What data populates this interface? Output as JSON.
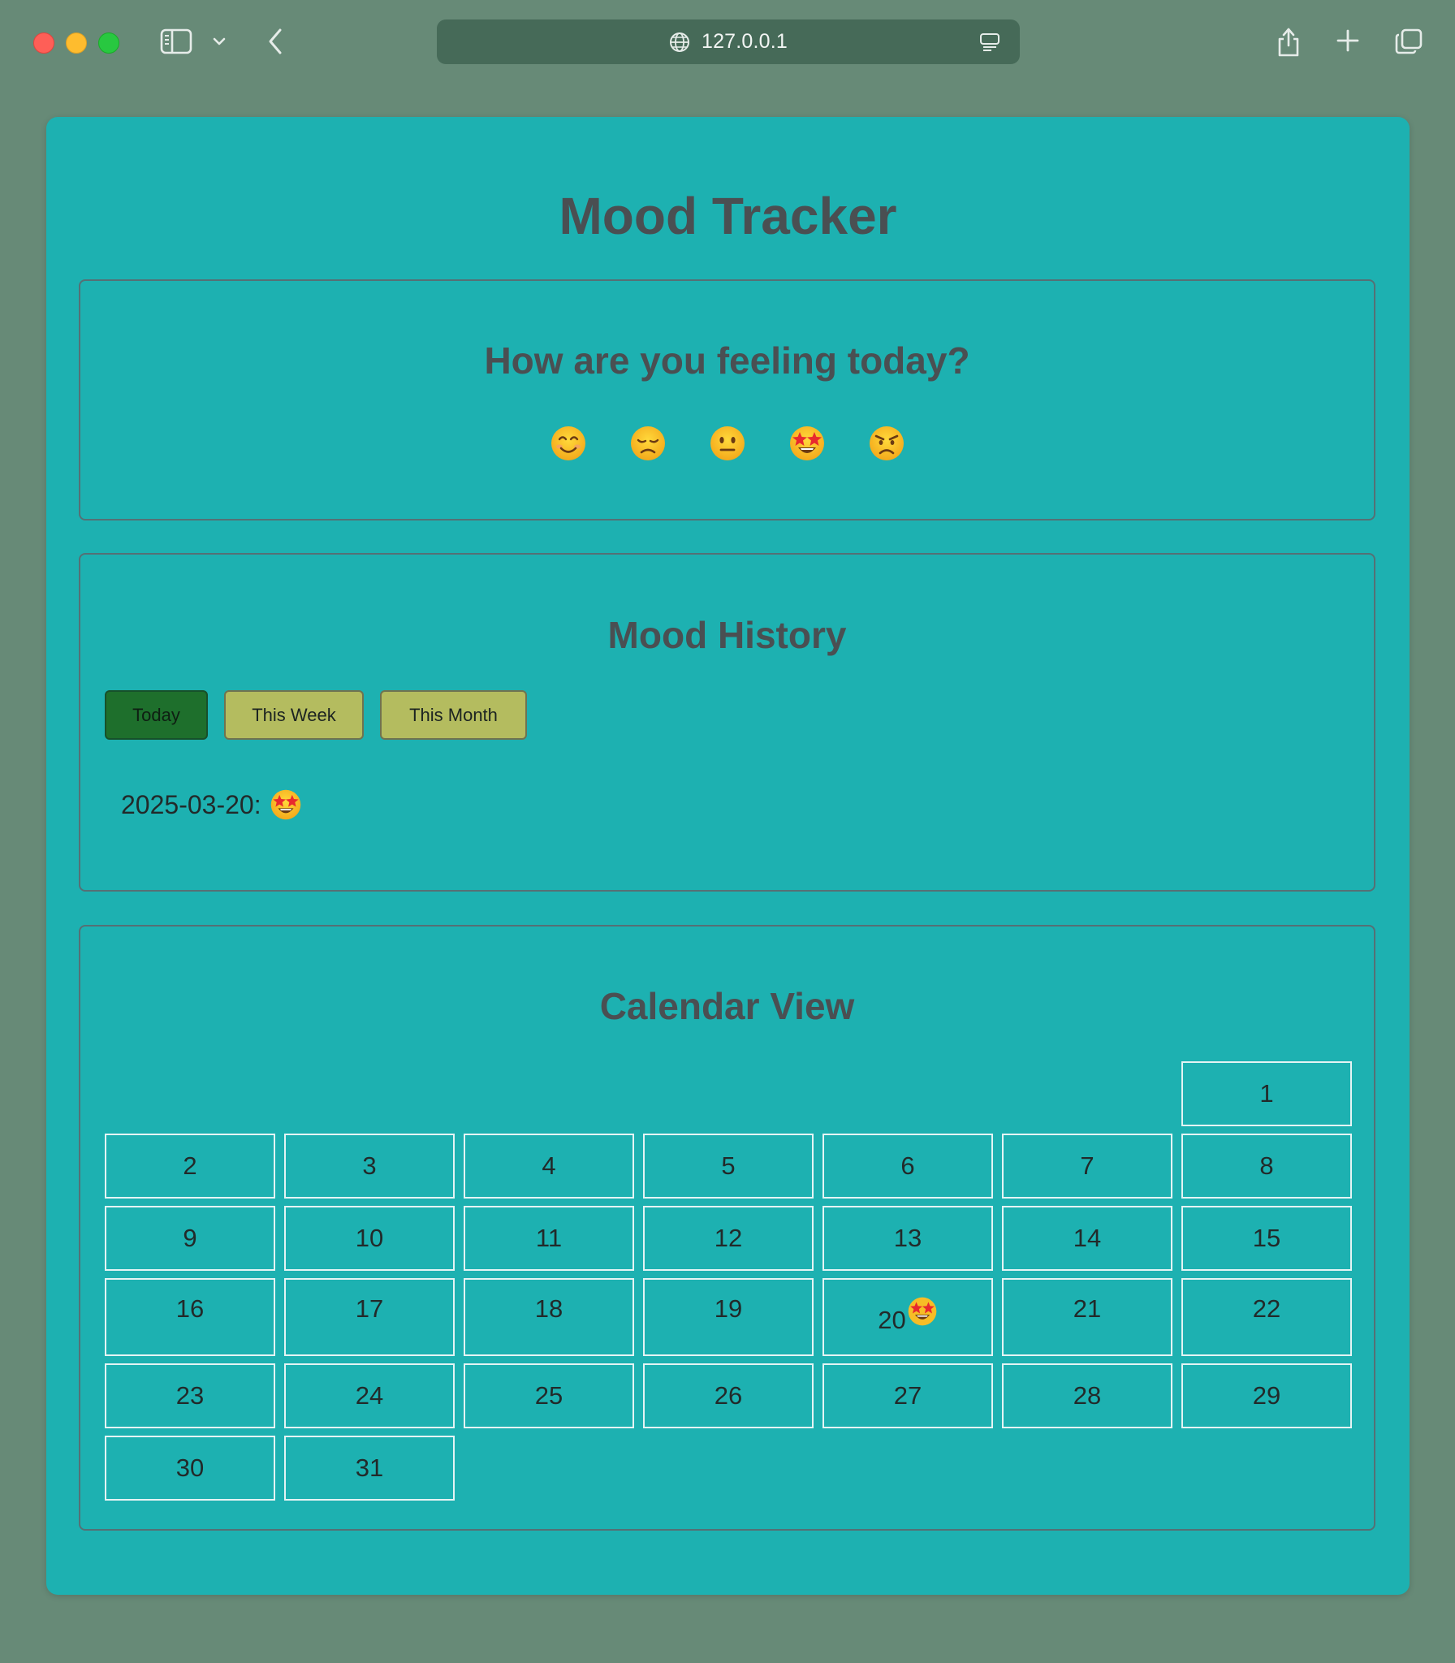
{
  "browser": {
    "address": "127.0.0.1"
  },
  "app": {
    "title": "Mood Tracker"
  },
  "mood_picker": {
    "heading": "How are you feeling today?",
    "options": [
      {
        "name": "happy",
        "icon": "smiling-face-icon"
      },
      {
        "name": "sad",
        "icon": "disappointed-face-icon"
      },
      {
        "name": "neutral",
        "icon": "neutral-face-icon"
      },
      {
        "name": "excited",
        "icon": "star-struck-face-icon"
      },
      {
        "name": "angry",
        "icon": "angry-face-icon"
      }
    ]
  },
  "history": {
    "heading": "Mood History",
    "tabs": [
      {
        "label": "Today",
        "active": true
      },
      {
        "label": "This Week",
        "active": false
      },
      {
        "label": "This Month",
        "active": false
      }
    ],
    "entries": [
      {
        "date": "2025-03-20:",
        "mood_icon": "star-struck-face-icon"
      }
    ]
  },
  "calendar": {
    "heading": "Calendar View",
    "first_weekday_index": 6,
    "days": [
      {
        "d": "1"
      },
      {
        "d": "2"
      },
      {
        "d": "3"
      },
      {
        "d": "4"
      },
      {
        "d": "5"
      },
      {
        "d": "6"
      },
      {
        "d": "7"
      },
      {
        "d": "8"
      },
      {
        "d": "9"
      },
      {
        "d": "10"
      },
      {
        "d": "11"
      },
      {
        "d": "12"
      },
      {
        "d": "13"
      },
      {
        "d": "14"
      },
      {
        "d": "15"
      },
      {
        "d": "16"
      },
      {
        "d": "17"
      },
      {
        "d": "18"
      },
      {
        "d": "19"
      },
      {
        "d": "20",
        "mood_icon": "star-struck-face-icon"
      },
      {
        "d": "21"
      },
      {
        "d": "22"
      },
      {
        "d": "23"
      },
      {
        "d": "24"
      },
      {
        "d": "25"
      },
      {
        "d": "26"
      },
      {
        "d": "27"
      },
      {
        "d": "28"
      },
      {
        "d": "29"
      },
      {
        "d": "30"
      },
      {
        "d": "31"
      }
    ]
  },
  "colors": {
    "window_bg": "#678a77",
    "app_bg": "#1db1b1",
    "heading": "#4a4f52",
    "tab_inactive": "#b4bc5f",
    "tab_active": "#1e6f2c",
    "cell_border": "#e4f4f4"
  }
}
